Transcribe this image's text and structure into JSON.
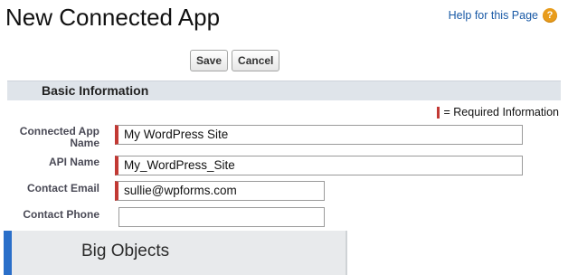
{
  "page": {
    "title": "New Connected App"
  },
  "help": {
    "label": "Help for this Page",
    "icon": "help-icon",
    "icon_glyph": "?"
  },
  "toolbar": {
    "save_label": "Save",
    "cancel_label": "Cancel"
  },
  "section": {
    "title": "Basic Information"
  },
  "legend": {
    "required_text": "= Required Information"
  },
  "form": {
    "connected_app_name": {
      "label": "Connected App Name",
      "value": "My WordPress Site",
      "required": true
    },
    "api_name": {
      "label": "API Name",
      "value": "My_WordPress_Site",
      "required": true
    },
    "contact_email": {
      "label": "Contact Email",
      "value": "sullie@wpforms.com",
      "required": true
    },
    "contact_phone": {
      "label": "Contact Phone",
      "value": "",
      "required": false
    }
  },
  "bottom_nav": {
    "label": "Big Objects"
  },
  "colors": {
    "required": "#c23934",
    "link": "#1a5aa6",
    "help_icon": "#e89c1c",
    "section_bg": "#dfe4ea",
    "nav_accent": "#2a6fc9"
  }
}
